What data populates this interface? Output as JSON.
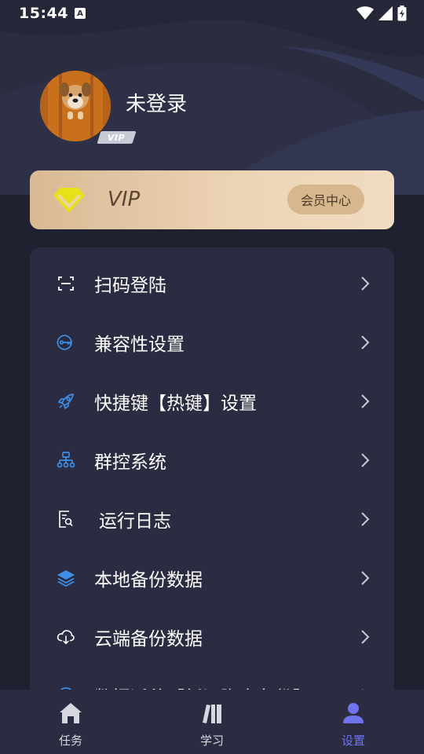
{
  "status_bar": {
    "time": "15:44",
    "notification_badge": "A",
    "icons": [
      "wifi-icon",
      "signal-icon",
      "battery-charging-icon"
    ]
  },
  "profile": {
    "name": "未登录",
    "vip_badge": "VIP",
    "avatar": "dog-photo"
  },
  "vip_card": {
    "label": "VIP",
    "center_button": "会员中心",
    "icon": "diamond-icon"
  },
  "menu": {
    "items": [
      {
        "label": "扫码登陆",
        "icon": "scan-icon"
      },
      {
        "label": "兼容性设置",
        "icon": "key-icon"
      },
      {
        "label": "快捷键【热键】设置",
        "icon": "rocket-icon"
      },
      {
        "label": "群控系统",
        "icon": "hierarchy-icon"
      },
      {
        "label": "运行日志",
        "icon": "log-search-icon"
      },
      {
        "label": "本地备份数据",
        "icon": "layers-icon"
      },
      {
        "label": "云端备份数据",
        "icon": "cloud-download-icon"
      },
      {
        "label": "数据迁移【新旧脚本备份】",
        "icon": "migrate-icon"
      }
    ]
  },
  "bottom_nav": {
    "items": [
      {
        "label": "任务",
        "icon": "home-icon"
      },
      {
        "label": "学习",
        "icon": "books-icon"
      },
      {
        "label": "设置",
        "icon": "user-icon"
      }
    ],
    "active": "设置"
  },
  "colors": {
    "background": "#1f2030",
    "panel": "#2b2c41",
    "accent": "#6f73ee",
    "vip_gold": "#ecd3b4",
    "icon_blue": "#3d8fe8"
  }
}
